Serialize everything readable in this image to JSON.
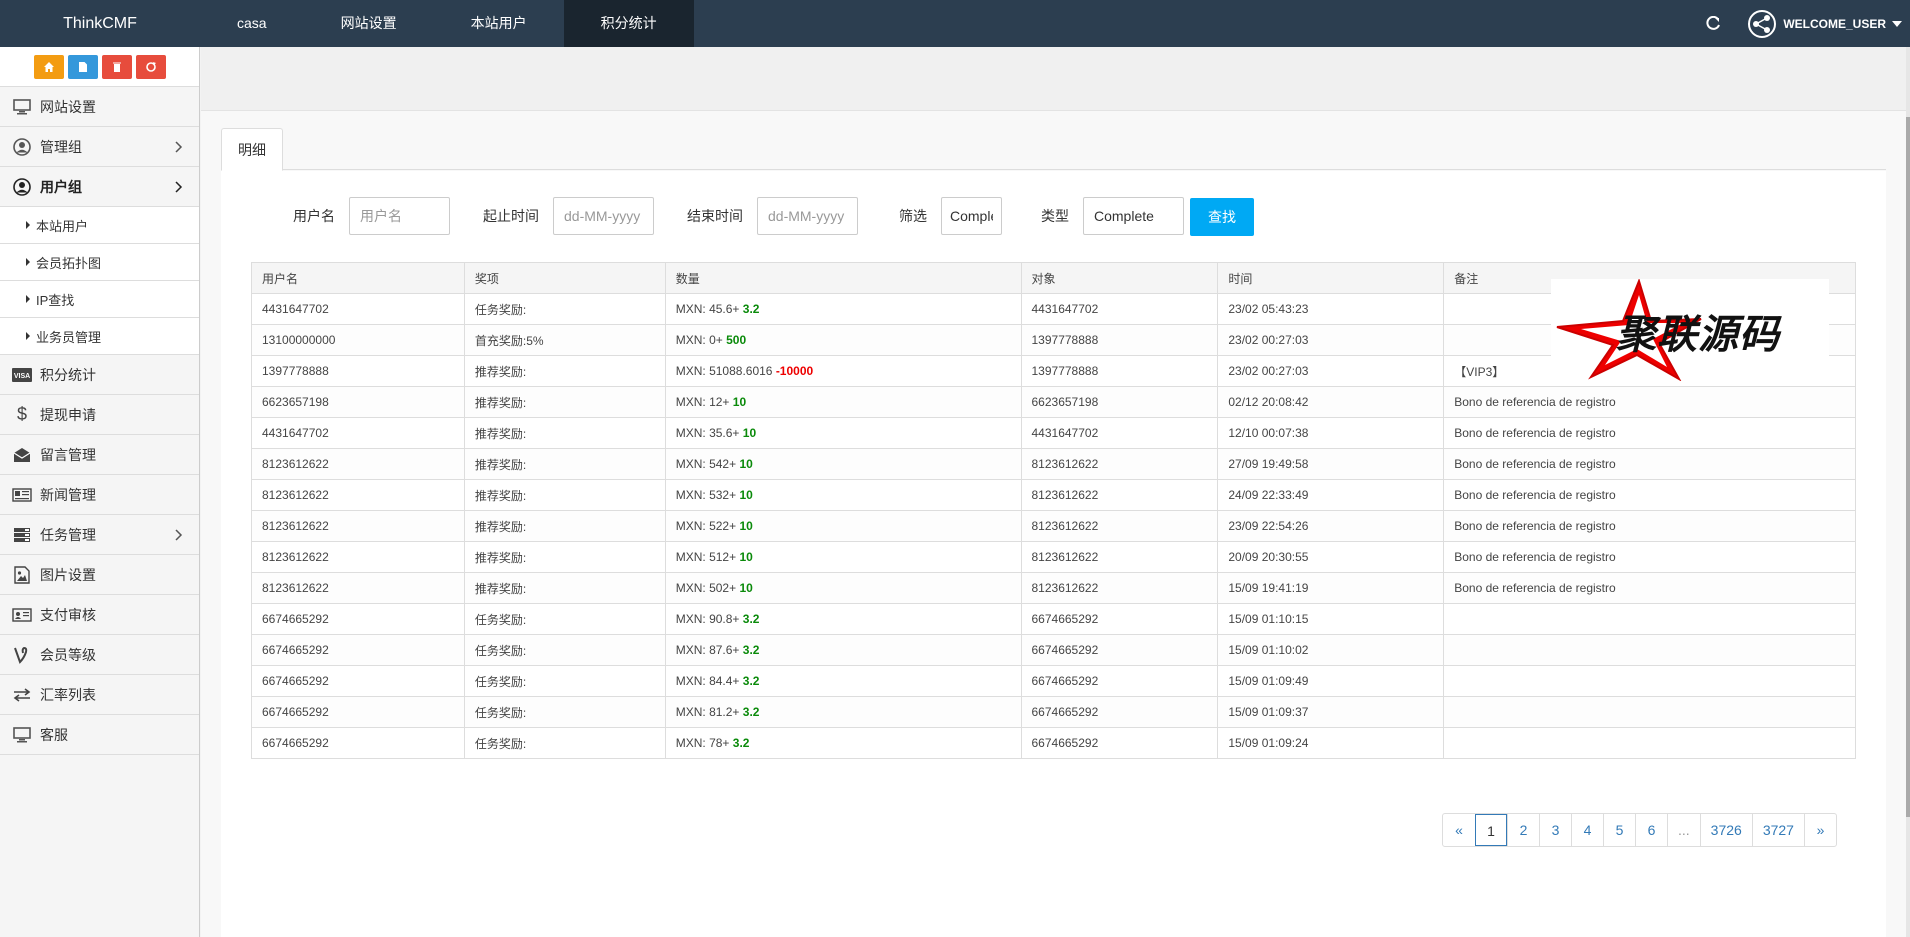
{
  "brand": "ThinkCMF",
  "topnav": [
    "casa",
    "网站设置",
    "本站用户",
    "积分统计"
  ],
  "user": {
    "welcome": "WELCOME_USER"
  },
  "sidebar": {
    "items": [
      {
        "label": "网站设置",
        "icon": "monitor-icon"
      },
      {
        "label": "管理组",
        "icon": "user-circle-icon"
      },
      {
        "label": "用户组",
        "icon": "user-circle-icon"
      },
      {
        "label": "积分统计",
        "icon": "visa-icon"
      },
      {
        "label": "提现申请",
        "icon": "dollar-icon"
      },
      {
        "label": "留言管理",
        "icon": "envelope-icon"
      },
      {
        "label": "新闻管理",
        "icon": "newspaper-icon"
      },
      {
        "label": "任务管理",
        "icon": "tasks-icon"
      },
      {
        "label": "图片设置",
        "icon": "image-icon"
      },
      {
        "label": "支付审核",
        "icon": "id-card-icon"
      },
      {
        "label": "会员等级",
        "icon": "vine-icon"
      },
      {
        "label": "汇率列表",
        "icon": "exchange-icon"
      },
      {
        "label": "客服",
        "icon": "monitor-icon"
      }
    ],
    "subitems": [
      "本站用户",
      "会员拓扑图",
      "IP查找",
      "业务员管理"
    ]
  },
  "tab": "明细",
  "filters": {
    "username_label": "用户名",
    "username_placeholder": "用户名",
    "start_label": "起止时间",
    "start_placeholder": "dd-MM-yyyy",
    "end_label": "结束时间",
    "end_placeholder": "dd-MM-yyyy",
    "filter_label": "筛选",
    "filter_value": "Comple",
    "type_label": "类型",
    "type_value": "Complete",
    "search_btn": "查找"
  },
  "table": {
    "headers": [
      "用户名",
      "奖项",
      "数量",
      "对象",
      "时间",
      "备注"
    ],
    "rows": [
      {
        "user": "4431647702",
        "award": "任务奖励:",
        "base": "MXN: 45.6+",
        "amt": "3.2",
        "amt_color": "green",
        "target": "4431647702",
        "time": "23/02 05:43:23",
        "note": ""
      },
      {
        "user": "13100000000",
        "award": "首充奖励:5%",
        "base": "MXN: 0+",
        "amt": "500",
        "amt_color": "green",
        "target": "1397778888",
        "time": "23/02 00:27:03",
        "note": ""
      },
      {
        "user": "1397778888",
        "award": "推荐奖励:",
        "base": "MXN: 51088.6016",
        "amt": "-10000",
        "amt_color": "red",
        "target": "1397778888",
        "time": "23/02 00:27:03",
        "note": "【VIP3】"
      },
      {
        "user": "6623657198",
        "award": "推荐奖励:",
        "base": "MXN: 12+",
        "amt": "10",
        "amt_color": "green",
        "target": "6623657198",
        "time": "02/12 20:08:42",
        "note": "Bono de referencia de registro"
      },
      {
        "user": "4431647702",
        "award": "推荐奖励:",
        "base": "MXN: 35.6+",
        "amt": "10",
        "amt_color": "green",
        "target": "4431647702",
        "time": "12/10 00:07:38",
        "note": "Bono de referencia de registro"
      },
      {
        "user": "8123612622",
        "award": "推荐奖励:",
        "base": "MXN: 542+",
        "amt": "10",
        "amt_color": "green",
        "target": "8123612622",
        "time": "27/09 19:49:58",
        "note": "Bono de referencia de registro"
      },
      {
        "user": "8123612622",
        "award": "推荐奖励:",
        "base": "MXN: 532+",
        "amt": "10",
        "amt_color": "green",
        "target": "8123612622",
        "time": "24/09 22:33:49",
        "note": "Bono de referencia de registro"
      },
      {
        "user": "8123612622",
        "award": "推荐奖励:",
        "base": "MXN: 522+",
        "amt": "10",
        "amt_color": "green",
        "target": "8123612622",
        "time": "23/09 22:54:26",
        "note": "Bono de referencia de registro"
      },
      {
        "user": "8123612622",
        "award": "推荐奖励:",
        "base": "MXN: 512+",
        "amt": "10",
        "amt_color": "green",
        "target": "8123612622",
        "time": "20/09 20:30:55",
        "note": "Bono de referencia de registro"
      },
      {
        "user": "8123612622",
        "award": "推荐奖励:",
        "base": "MXN: 502+",
        "amt": "10",
        "amt_color": "green",
        "target": "8123612622",
        "time": "15/09 19:41:19",
        "note": "Bono de referencia de registro"
      },
      {
        "user": "6674665292",
        "award": "任务奖励:",
        "base": "MXN: 90.8+",
        "amt": "3.2",
        "amt_color": "green",
        "target": "6674665292",
        "time": "15/09 01:10:15",
        "note": ""
      },
      {
        "user": "6674665292",
        "award": "任务奖励:",
        "base": "MXN: 87.6+",
        "amt": "3.2",
        "amt_color": "green",
        "target": "6674665292",
        "time": "15/09 01:10:02",
        "note": ""
      },
      {
        "user": "6674665292",
        "award": "任务奖励:",
        "base": "MXN: 84.4+",
        "amt": "3.2",
        "amt_color": "green",
        "target": "6674665292",
        "time": "15/09 01:09:49",
        "note": ""
      },
      {
        "user": "6674665292",
        "award": "任务奖励:",
        "base": "MXN: 81.2+",
        "amt": "3.2",
        "amt_color": "green",
        "target": "6674665292",
        "time": "15/09 01:09:37",
        "note": ""
      },
      {
        "user": "6674665292",
        "award": "任务奖励:",
        "base": "MXN: 78+",
        "amt": "3.2",
        "amt_color": "green",
        "target": "6674665292",
        "time": "15/09 01:09:24",
        "note": ""
      }
    ]
  },
  "pagination": [
    "«",
    "1",
    "2",
    "3",
    "4",
    "5",
    "6",
    "...",
    "3726",
    "3727",
    "»"
  ],
  "pagination_active": "1",
  "watermark": "聚联源码",
  "colors": {
    "topbar": "#2c3e50",
    "accent": "#00a9f4",
    "green": "#0a8a0a",
    "red": "#ee0000"
  }
}
